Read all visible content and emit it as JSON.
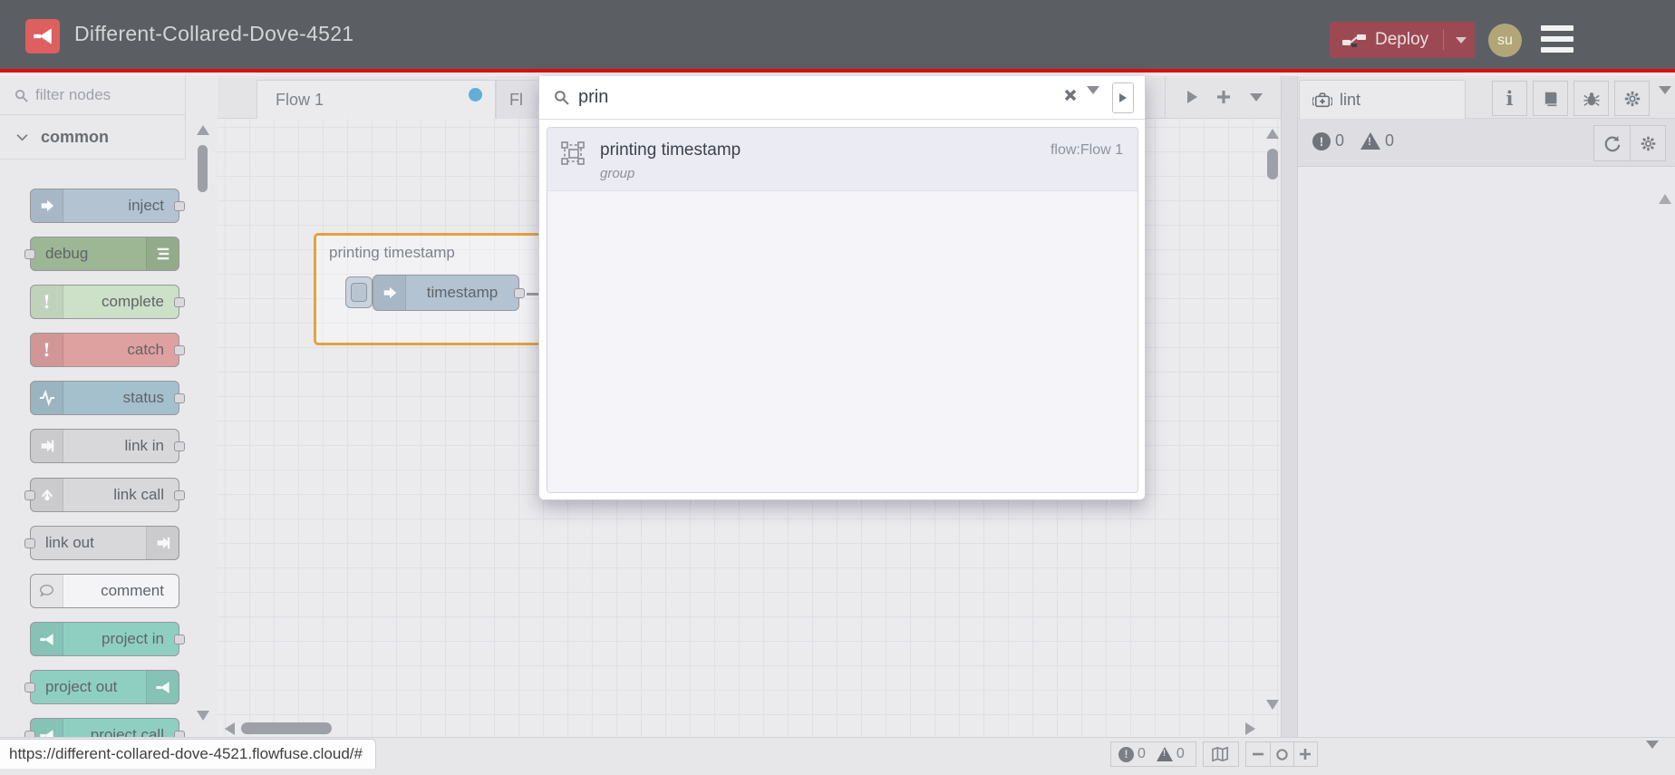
{
  "header": {
    "title": "Different-Collared-Dove-4521",
    "deploy_label": "Deploy",
    "avatar_initials": "su"
  },
  "palette": {
    "filter_placeholder": "filter nodes",
    "category": "common",
    "nodes": [
      {
        "label": "inject",
        "color": "#b3c3d2"
      },
      {
        "label": "debug",
        "color": "#9db694"
      },
      {
        "label": "complete",
        "color": "#cde0c8"
      },
      {
        "label": "catch",
        "color": "#dfa0a0"
      },
      {
        "label": "status",
        "color": "#a4c0cc"
      },
      {
        "label": "link in",
        "color": "#d8d8db"
      },
      {
        "label": "link call",
        "color": "#d8d8db"
      },
      {
        "label": "link out",
        "color": "#d8d8db"
      },
      {
        "label": "comment",
        "color": "#f4f4f6"
      },
      {
        "label": "project in",
        "color": "#8fcfc2"
      },
      {
        "label": "project out",
        "color": "#8fcfc2"
      },
      {
        "label": "project call",
        "color": "#8fcfc2"
      }
    ]
  },
  "tabs": {
    "flow1": "Flow 1",
    "flow2": "Fl"
  },
  "canvas": {
    "group_label": "printing timestamp",
    "node_label": "timestamp"
  },
  "search": {
    "query": "prin",
    "result": {
      "title": "printing timestamp",
      "type": "group",
      "flow": "flow:Flow 1"
    }
  },
  "sidebar": {
    "tab_label": "lint",
    "error_count": "0",
    "warning_count": "0"
  },
  "footer": {
    "error_count": "0",
    "warning_count": "0",
    "zoom_out": "−",
    "zoom_reset": "",
    "zoom_in": "+"
  },
  "statusbar": {
    "url": "https://different-collared-dove-4521.flowfuse.cloud/#"
  },
  "colors": {
    "header_bg": "#5b5f64",
    "accent_red": "#da1010",
    "logo_red": "#dd5f5f",
    "deploy_red": "#9d4953",
    "group_highlight": "#e4a23f",
    "tab_dot_blue": "#62aed6",
    "project_teal": "#8fcfc2"
  }
}
